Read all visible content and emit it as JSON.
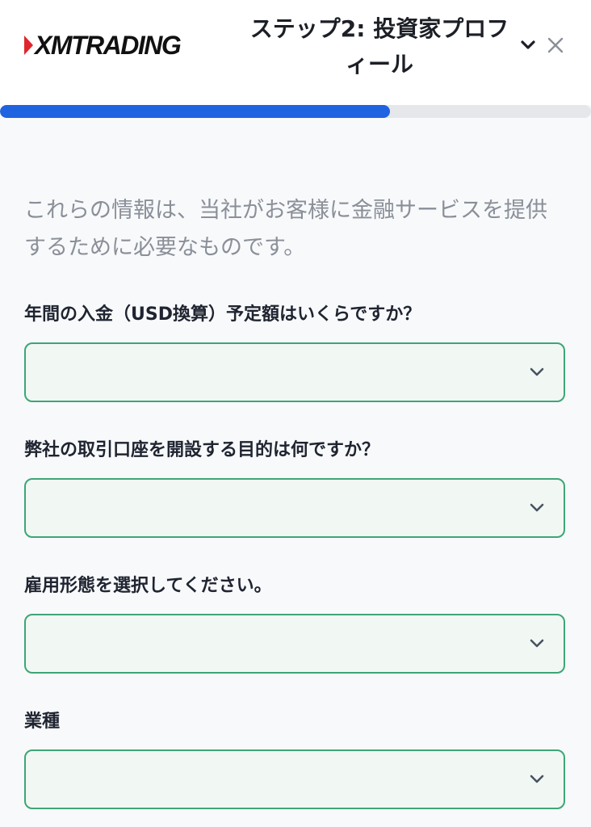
{
  "brand": {
    "logo_text": "XMTRADING",
    "accent_color": "#e0262d"
  },
  "header": {
    "step_title_line1": "ステップ2: 投資家プロフ",
    "step_title_line2": "ィール",
    "chevron_icon": "chevron-down-icon",
    "close_icon": "close-icon"
  },
  "progress": {
    "fraction": 0.66,
    "color": "#1f63e0"
  },
  "intro": {
    "line1": "これらの情報は、当社がお客様に金融サービスを提供",
    "line2": "するために必要なものです。"
  },
  "questions": [
    {
      "label": "年間の入金（USD換算）予定額はいくらですか？",
      "value": ""
    },
    {
      "label": "弊社の取引口座を開設する目的は何ですか？",
      "value": ""
    },
    {
      "label": "雇用形態を選択してください。",
      "value": ""
    },
    {
      "label": "業種",
      "value": ""
    }
  ]
}
